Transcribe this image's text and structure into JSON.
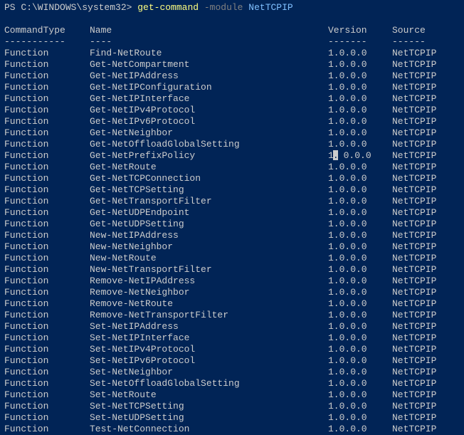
{
  "prompt": {
    "prefix": "PS C:\\WINDOWS\\system32> ",
    "command": "get-command",
    "param": "-module",
    "arg": "NetTCPIP"
  },
  "headers": {
    "type": "CommandType",
    "name": "Name",
    "version": "Version",
    "source": "Source"
  },
  "underlines": {
    "type": "-----------",
    "name": "----",
    "version": "-------",
    "source": "------"
  },
  "rows": [
    {
      "type": "Function",
      "name": "Find-NetRoute",
      "version": "1.0.0.0",
      "source": "NetTCPIP",
      "cursor": false
    },
    {
      "type": "Function",
      "name": "Get-NetCompartment",
      "version": "1.0.0.0",
      "source": "NetTCPIP",
      "cursor": false
    },
    {
      "type": "Function",
      "name": "Get-NetIPAddress",
      "version": "1.0.0.0",
      "source": "NetTCPIP",
      "cursor": false
    },
    {
      "type": "Function",
      "name": "Get-NetIPConfiguration",
      "version": "1.0.0.0",
      "source": "NetTCPIP",
      "cursor": false
    },
    {
      "type": "Function",
      "name": "Get-NetIPInterface",
      "version": "1.0.0.0",
      "source": "NetTCPIP",
      "cursor": false
    },
    {
      "type": "Function",
      "name": "Get-NetIPv4Protocol",
      "version": "1.0.0.0",
      "source": "NetTCPIP",
      "cursor": false
    },
    {
      "type": "Function",
      "name": "Get-NetIPv6Protocol",
      "version": "1.0.0.0",
      "source": "NetTCPIP",
      "cursor": false
    },
    {
      "type": "Function",
      "name": "Get-NetNeighbor",
      "version": "1.0.0.0",
      "source": "NetTCPIP",
      "cursor": false
    },
    {
      "type": "Function",
      "name": "Get-NetOffloadGlobalSetting",
      "version": "1.0.0.0",
      "source": "NetTCPIP",
      "cursor": false
    },
    {
      "type": "Function",
      "name": "Get-NetPrefixPolicy",
      "version": "1.0.0.0",
      "source": "NetTCPIP",
      "cursor": true
    },
    {
      "type": "Function",
      "name": "Get-NetRoute",
      "version": "1.0.0.0",
      "source": "NetTCPIP",
      "cursor": false
    },
    {
      "type": "Function",
      "name": "Get-NetTCPConnection",
      "version": "1.0.0.0",
      "source": "NetTCPIP",
      "cursor": false
    },
    {
      "type": "Function",
      "name": "Get-NetTCPSetting",
      "version": "1.0.0.0",
      "source": "NetTCPIP",
      "cursor": false
    },
    {
      "type": "Function",
      "name": "Get-NetTransportFilter",
      "version": "1.0.0.0",
      "source": "NetTCPIP",
      "cursor": false
    },
    {
      "type": "Function",
      "name": "Get-NetUDPEndpoint",
      "version": "1.0.0.0",
      "source": "NetTCPIP",
      "cursor": false
    },
    {
      "type": "Function",
      "name": "Get-NetUDPSetting",
      "version": "1.0.0.0",
      "source": "NetTCPIP",
      "cursor": false
    },
    {
      "type": "Function",
      "name": "New-NetIPAddress",
      "version": "1.0.0.0",
      "source": "NetTCPIP",
      "cursor": false
    },
    {
      "type": "Function",
      "name": "New-NetNeighbor",
      "version": "1.0.0.0",
      "source": "NetTCPIP",
      "cursor": false
    },
    {
      "type": "Function",
      "name": "New-NetRoute",
      "version": "1.0.0.0",
      "source": "NetTCPIP",
      "cursor": false
    },
    {
      "type": "Function",
      "name": "New-NetTransportFilter",
      "version": "1.0.0.0",
      "source": "NetTCPIP",
      "cursor": false
    },
    {
      "type": "Function",
      "name": "Remove-NetIPAddress",
      "version": "1.0.0.0",
      "source": "NetTCPIP",
      "cursor": false
    },
    {
      "type": "Function",
      "name": "Remove-NetNeighbor",
      "version": "1.0.0.0",
      "source": "NetTCPIP",
      "cursor": false
    },
    {
      "type": "Function",
      "name": "Remove-NetRoute",
      "version": "1.0.0.0",
      "source": "NetTCPIP",
      "cursor": false
    },
    {
      "type": "Function",
      "name": "Remove-NetTransportFilter",
      "version": "1.0.0.0",
      "source": "NetTCPIP",
      "cursor": false
    },
    {
      "type": "Function",
      "name": "Set-NetIPAddress",
      "version": "1.0.0.0",
      "source": "NetTCPIP",
      "cursor": false
    },
    {
      "type": "Function",
      "name": "Set-NetIPInterface",
      "version": "1.0.0.0",
      "source": "NetTCPIP",
      "cursor": false
    },
    {
      "type": "Function",
      "name": "Set-NetIPv4Protocol",
      "version": "1.0.0.0",
      "source": "NetTCPIP",
      "cursor": false
    },
    {
      "type": "Function",
      "name": "Set-NetIPv6Protocol",
      "version": "1.0.0.0",
      "source": "NetTCPIP",
      "cursor": false
    },
    {
      "type": "Function",
      "name": "Set-NetNeighbor",
      "version": "1.0.0.0",
      "source": "NetTCPIP",
      "cursor": false
    },
    {
      "type": "Function",
      "name": "Set-NetOffloadGlobalSetting",
      "version": "1.0.0.0",
      "source": "NetTCPIP",
      "cursor": false
    },
    {
      "type": "Function",
      "name": "Set-NetRoute",
      "version": "1.0.0.0",
      "source": "NetTCPIP",
      "cursor": false
    },
    {
      "type": "Function",
      "name": "Set-NetTCPSetting",
      "version": "1.0.0.0",
      "source": "NetTCPIP",
      "cursor": false
    },
    {
      "type": "Function",
      "name": "Set-NetUDPSetting",
      "version": "1.0.0.0",
      "source": "NetTCPIP",
      "cursor": false
    },
    {
      "type": "Function",
      "name": "Test-NetConnection",
      "version": "1.0.0.0",
      "source": "NetTCPIP",
      "cursor": false
    }
  ]
}
